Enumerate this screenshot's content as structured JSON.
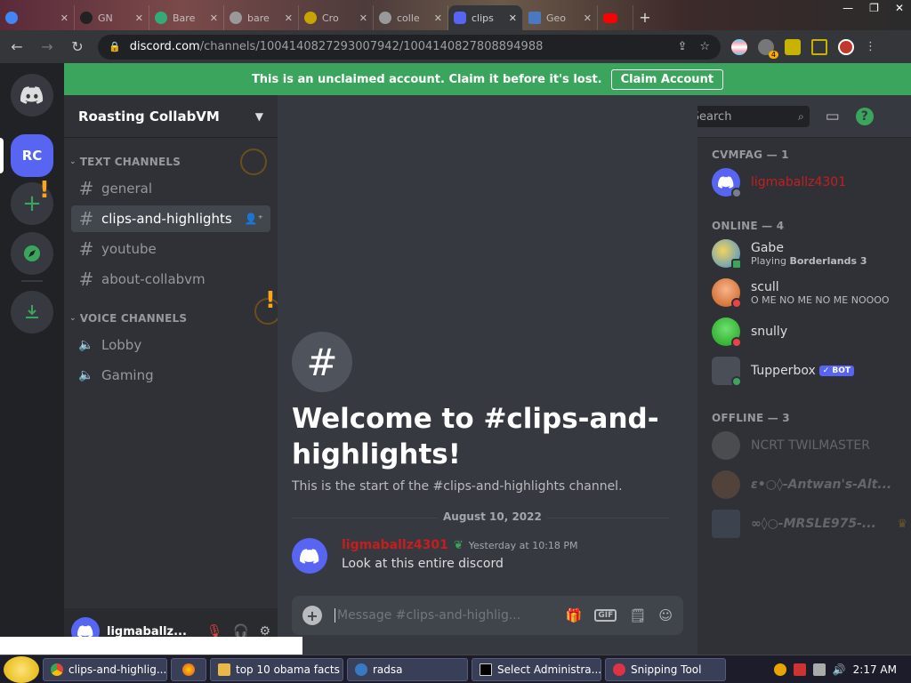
{
  "browser": {
    "tabs": [
      {
        "title": "",
        "icon": "google-icon",
        "color": "#4285f4"
      },
      {
        "title": "GN",
        "icon": "gnu-icon",
        "color": "#222222"
      },
      {
        "title": "Bare",
        "icon": "wikimedia-icon",
        "color": "#3a7"
      },
      {
        "title": "bare",
        "icon": "bing-icon",
        "color": "#999"
      },
      {
        "title": "Cro",
        "icon": "chrome-web-icon",
        "color": "#c8a400"
      },
      {
        "title": "colle",
        "icon": "tab-icon",
        "color": "#999"
      },
      {
        "title": "clips",
        "icon": "discord-icon",
        "color": "#5865f2",
        "active": true
      },
      {
        "title": "Geo",
        "icon": "triangle-icon",
        "color": "#4a78c2"
      },
      {
        "title": "",
        "icon": "youtube-icon",
        "color": "#ff0000"
      }
    ],
    "url_host": "discord.com",
    "url_path": "/channels/1004140827293007942/1004140827808894988",
    "extension_badge": "4"
  },
  "banner": {
    "text": "This is an unclaimed account. Claim it before it's lost.",
    "button": "Claim Account"
  },
  "guilds": {
    "server_initials": "RC"
  },
  "server": {
    "name": "Roasting CollabVM",
    "text_category": "TEXT CHANNELS",
    "voice_category": "VOICE CHANNELS",
    "text_channels": [
      "general",
      "clips-and-highlights",
      "youtube",
      "about-collabvm"
    ],
    "voice_channels": [
      "Lobby",
      "Gaming"
    ]
  },
  "user": {
    "name": "ligmaballz..."
  },
  "channel": {
    "name": "clips-and-highlights",
    "search_placeholder": "Search",
    "welcome_title": "Welcome to #clips-and-highlights!",
    "welcome_sub": "This is the start of the #clips-and-highlights channel.",
    "date_divider": "August 10, 2022",
    "message": {
      "author": "ligmaballz4301",
      "time": "Yesterday at 10:18 PM",
      "content": "Look at this entire discord"
    },
    "composer_placeholder": "Message #clips-and-highlig...",
    "gif_label": "GIF"
  },
  "members": {
    "role_header": "CVMFAG — 1",
    "role_members": [
      {
        "name": "ligmaballz4301",
        "color": "#c61e1e"
      }
    ],
    "online_header": "ONLINE — 4",
    "online": [
      {
        "name": "Gabe",
        "activity_prefix": "Playing ",
        "activity": "Borderlands 3",
        "status": "#3ba55d"
      },
      {
        "name": "scull",
        "activity_prefix": "",
        "activity": "O ME NO ME NO ME NOOOO",
        "status": "#ed4245"
      },
      {
        "name": "snully",
        "activity_prefix": "",
        "activity": "",
        "status": "#ed4245"
      },
      {
        "name": "Tupperbox",
        "activity_prefix": "",
        "activity": "",
        "status": "#3ba55d",
        "bot_badge": "✓ BOT"
      }
    ],
    "offline_header": "OFFLINE — 3",
    "offline": [
      {
        "name": "NCRT TWILMASTER"
      },
      {
        "name": "ε•○◊-Antwan's-Alt..."
      },
      {
        "name": "∞◊○-MRSLE975-..."
      }
    ]
  },
  "taskbar": {
    "tasks": [
      "clips-and-highlig...",
      "top 10 obama facts",
      "radsa",
      "Select Administra...",
      "Snipping Tool"
    ],
    "clock": "2:17 AM"
  }
}
